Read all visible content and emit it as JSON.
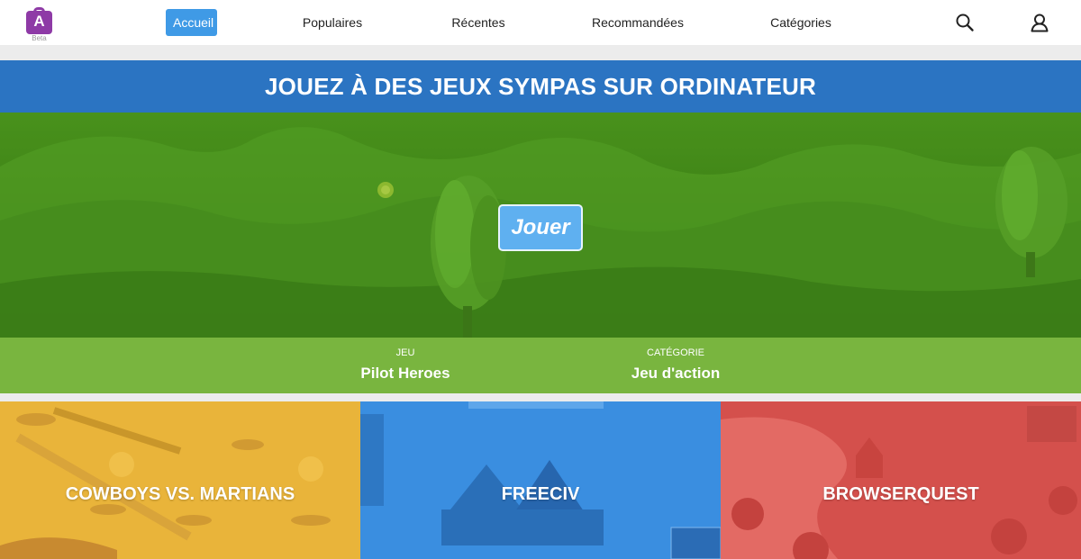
{
  "nav": {
    "logo_letter": "A",
    "logo_badge": "Beta",
    "items": [
      {
        "label": "Accueil",
        "active": true
      },
      {
        "label": "Populaires",
        "active": false
      },
      {
        "label": "Récentes",
        "active": false
      },
      {
        "label": "Recommandées",
        "active": false
      },
      {
        "label": "Catégories",
        "active": false
      }
    ],
    "icons": [
      "search-icon",
      "user-icon"
    ]
  },
  "banner": {
    "title": "JOUEZ À DES JEUX SYMPAS SUR ORDINATEUR"
  },
  "hero": {
    "play_label": "Jouer"
  },
  "featured": {
    "game_label": "JEU",
    "game_value": "Pilot Heroes",
    "category_label": "CATÉGORIE",
    "category_value": "Jeu d'action"
  },
  "tiles": [
    {
      "title": "COWBOYS VS. MARTIANS",
      "color": "#e9b43a"
    },
    {
      "title": "FREECIV",
      "color": "#3a8ee0"
    },
    {
      "title": "BROWSERQUEST",
      "color": "#e05a55"
    }
  ],
  "colors": {
    "nav_active": "#3f9ae6",
    "banner": "#2b74c2",
    "hero_green": "#418818",
    "info_bar": "#79b53f",
    "play_button": "#5fb0f0",
    "logo": "#8e3aa6"
  }
}
